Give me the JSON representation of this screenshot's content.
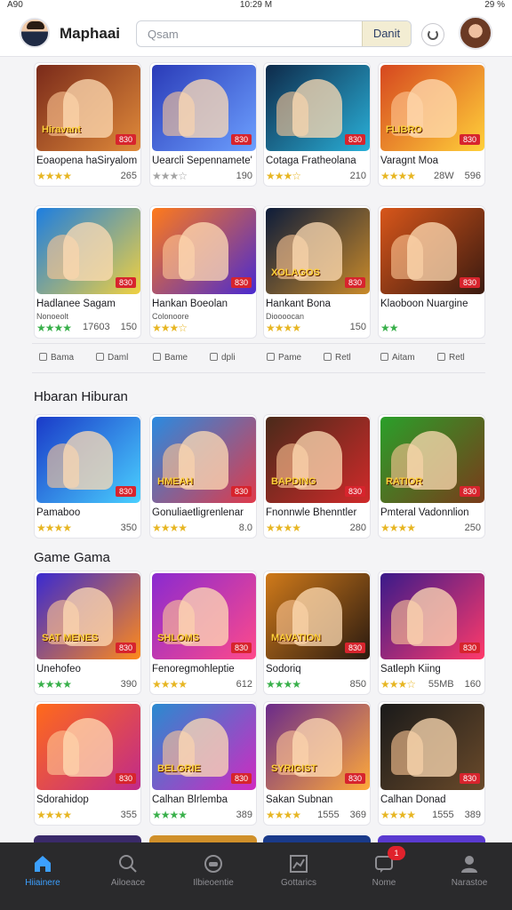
{
  "status": {
    "left": "A90",
    "center": "10:29 M",
    "right": "29 %"
  },
  "header": {
    "brand": "Maphaai",
    "search_placeholder": "Qsam",
    "search_button": "Danit"
  },
  "grid_top": [
    {
      "title": "Eoaopena haSiryalom",
      "meta": "265",
      "tag": "830",
      "thumb_label": "Hiravant",
      "stars": "★★★★",
      "star_color": "gold",
      "colors": [
        "#7a2a1a",
        "#e08a3a"
      ]
    },
    {
      "title": "Uearcli Sepennamete'",
      "meta": "190",
      "tag": "830",
      "thumb_label": "",
      "stars": "★★★☆",
      "star_color": "gray",
      "colors": [
        "#2a3bb8",
        "#6da0ff"
      ]
    },
    {
      "title": "Cotaga Fratheolana",
      "meta": "210",
      "tag": "830",
      "thumb_label": "",
      "stars": "★★★☆",
      "star_color": "gold",
      "colors": [
        "#0e2a4a",
        "#2ab0d8"
      ]
    },
    {
      "title": "Varagnt Moa",
      "meta": "596",
      "meta2": "28W",
      "tag": "830",
      "thumb_label": "FLIBRO",
      "stars": "★★★★",
      "star_color": "gold",
      "colors": [
        "#d6471f",
        "#ffd03a"
      ]
    },
    {
      "title": "Hadlanee Sagam",
      "subtitle": "Nonoeolt",
      "meta": "150",
      "meta2": "17603",
      "tag": "830",
      "thumb_label": "",
      "stars": "★★★★",
      "star_color": "green",
      "colors": [
        "#1d7ee0",
        "#f0d040"
      ]
    },
    {
      "title": "Hankan Boeolan",
      "subtitle": "Colonoore",
      "meta": "",
      "tag": "830",
      "thumb_label": "",
      "stars": "★★★☆",
      "star_color": "gold",
      "colors": [
        "#ff7a1a",
        "#4a2ad0"
      ]
    },
    {
      "title": "Hankant Bona",
      "subtitle": "Dioooocan",
      "meta": "150",
      "tag": "830",
      "thumb_label": "XOLAGOS",
      "stars": "★★★★",
      "star_color": "gold",
      "colors": [
        "#0d1c3a",
        "#c98a2a"
      ]
    },
    {
      "title": "Klaoboon Nuargine",
      "meta": "",
      "tag": "830",
      "thumb_label": "",
      "stars": "★★",
      "star_color": "green",
      "colors": [
        "#d8561a",
        "#3a1a10"
      ]
    }
  ],
  "tabs": [
    {
      "label": "Bama"
    },
    {
      "label": "Daml"
    },
    {
      "label": "Bame"
    },
    {
      "label": "dpli"
    },
    {
      "label": "Pame"
    },
    {
      "label": "Retl"
    },
    {
      "label": "Aitam"
    },
    {
      "label": "Retl"
    }
  ],
  "section1": {
    "title": "Hbaran Hiburan",
    "items": [
      {
        "title": "Pamaboo",
        "meta": "350",
        "tag": "830",
        "thumb_label": "",
        "stars": "★★★★",
        "star_color": "gold",
        "colors": [
          "#1a3ac8",
          "#4ad0ff"
        ]
      },
      {
        "title": "Gonuliaetligrenlenar",
        "meta": "8.0",
        "tag": "830",
        "thumb_label": "HMEAH",
        "stars": "★★★★",
        "star_color": "gold",
        "colors": [
          "#2a8ae0",
          "#e03a4a"
        ]
      },
      {
        "title": "Fnonnwle Bhenntler",
        "meta": "280",
        "tag": "830",
        "thumb_label": "BAPDING",
        "stars": "★★★★",
        "star_color": "gold",
        "colors": [
          "#4a2a1a",
          "#d02a2a"
        ]
      },
      {
        "title": "Pmteral Vadonnlion",
        "meta": "250",
        "tag": "830",
        "thumb_label": "RATIOR",
        "stars": "★★★★",
        "star_color": "gold",
        "colors": [
          "#2aa02a",
          "#7a3a1a"
        ]
      }
    ]
  },
  "section2": {
    "title": "Game Gama",
    "items": [
      {
        "title": "Unehofeo",
        "meta": "390",
        "tag": "830",
        "thumb_label": "SAT MENES",
        "stars": "★★★★",
        "star_color": "green",
        "colors": [
          "#3a2ad0",
          "#ff8a1a"
        ]
      },
      {
        "title": "Fenoregmohleptie",
        "meta": "612",
        "tag": "830",
        "thumb_label": "SHLOMS",
        "stars": "★★★★",
        "star_color": "gold",
        "colors": [
          "#8a2ad0",
          "#ff4a8a"
        ]
      },
      {
        "title": "Sodoriq",
        "meta": "850",
        "tag": "830",
        "thumb_label": "MAVATION",
        "stars": "★★★★",
        "star_color": "green",
        "colors": [
          "#d07a1a",
          "#2a1a10"
        ]
      },
      {
        "title": "Satleph Kiing",
        "meta": "160",
        "meta2": "55MB",
        "tag": "830",
        "thumb_label": "",
        "stars": "★★★☆",
        "star_color": "gold",
        "colors": [
          "#3a1a8a",
          "#ff3a6a"
        ]
      },
      {
        "title": "Sdorahidop",
        "meta": "355",
        "tag": "830",
        "thumb_label": "",
        "stars": "★★★★",
        "star_color": "gold",
        "colors": [
          "#ff6a1a",
          "#c02a8a"
        ]
      },
      {
        "title": "Calhan Blrlemba",
        "meta": "389",
        "tag": "830",
        "thumb_label": "BELGRIE",
        "stars": "★★★★",
        "star_color": "green",
        "colors": [
          "#2a8ad0",
          "#d02ac0"
        ]
      },
      {
        "title": "Sakan Subnan",
        "meta": "369",
        "meta2": "1555",
        "tag": "830",
        "thumb_label": "SYRIGIST",
        "stars": "★★★★",
        "star_color": "gold",
        "colors": [
          "#6a2a8a",
          "#ffaa3a"
        ]
      },
      {
        "title": "Calhan Donad",
        "meta": "389",
        "meta2": "1555",
        "tag": "830",
        "thumb_label": "",
        "stars": "★★★★",
        "star_color": "gold",
        "colors": [
          "#1a1a1a",
          "#6a4a2a"
        ]
      }
    ]
  },
  "bottom_nav": [
    {
      "label": "Hiiainere",
      "icon": "home-icon",
      "active": true
    },
    {
      "label": "Ailoeace",
      "icon": "search-icon",
      "active": false
    },
    {
      "label": "Ilbieoentie",
      "icon": "gamepad-icon",
      "active": false
    },
    {
      "label": "Gottarics",
      "icon": "chart-icon",
      "active": false
    },
    {
      "label": "Nome",
      "icon": "message-icon",
      "active": false,
      "badge": "1"
    },
    {
      "label": "Narastoe",
      "icon": "profile-icon",
      "active": false
    }
  ]
}
